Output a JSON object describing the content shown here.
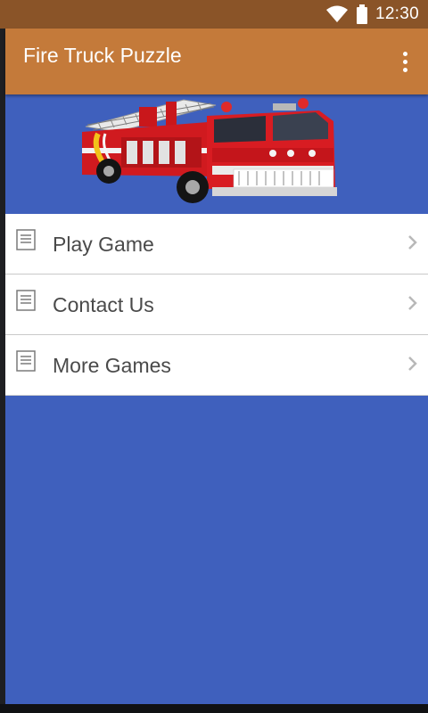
{
  "status_bar": {
    "time": "12:30",
    "icons": [
      "wifi-icon",
      "battery-icon"
    ]
  },
  "app_bar": {
    "title": "Fire Truck Puzzle",
    "overflow_icon": "more-vert-icon"
  },
  "banner": {
    "image": "fire-truck-image"
  },
  "menu": {
    "items": [
      {
        "label": "Play Game",
        "icon": "document-icon"
      },
      {
        "label": "Contact Us",
        "icon": "document-icon"
      },
      {
        "label": "More Games",
        "icon": "document-icon"
      }
    ]
  },
  "colors": {
    "status_bar": "#8a5428",
    "app_bar": "#c47a3a",
    "content_background": "#3f60bd",
    "menu_background": "#ffffff",
    "menu_text": "#4a4a4a"
  }
}
